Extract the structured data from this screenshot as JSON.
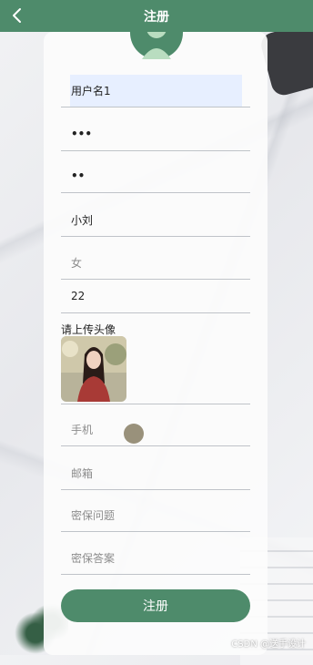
{
  "header": {
    "title": "注册"
  },
  "form": {
    "username": "用户名1",
    "password": "•••",
    "confirm_password": "••",
    "nickname": "小刘",
    "gender": "女",
    "age": "22",
    "upload_label": "请上传头像",
    "phone_placeholder": "手机",
    "email_placeholder": "邮箱",
    "question_placeholder": "密保问题",
    "answer_placeholder": "密保答案",
    "submit_label": "注册"
  },
  "watermark": "CSDN @送手设计",
  "colors": {
    "accent": "#4e8b6b",
    "username_highlight": "#e7efff"
  }
}
